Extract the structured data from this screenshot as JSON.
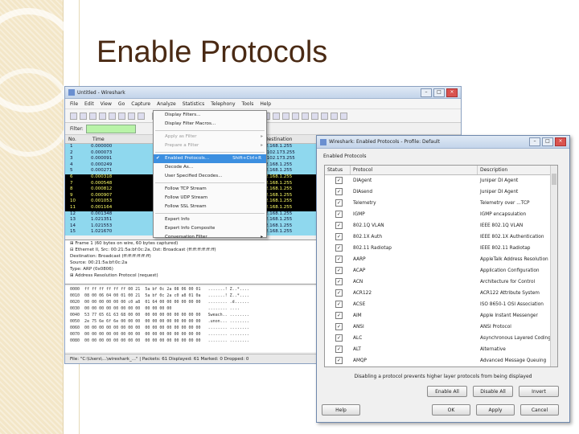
{
  "slide": {
    "title": "Enable Protocols"
  },
  "main_window": {
    "title": "Untitled - Wireshark",
    "menus": [
      "File",
      "Edit",
      "View",
      "Go",
      "Capture",
      "Analyze",
      "Statistics",
      "Telephony",
      "Tools",
      "Help"
    ],
    "filter_label": "Filter:",
    "packet_columns": [
      "No.",
      "Time",
      "Destination"
    ],
    "packets": [
      {
        "no": "1",
        "time": "0.000000",
        "dest": "192.168.1.255",
        "style": "c"
      },
      {
        "no": "2",
        "time": "0.000073",
        "dest": "66.102.173.255",
        "style": "c"
      },
      {
        "no": "3",
        "time": "0.000091",
        "dest": "66.102.173.255",
        "style": "c"
      },
      {
        "no": "4",
        "time": "0.000249",
        "dest": "192.168.1.255",
        "style": "c"
      },
      {
        "no": "5",
        "time": "0.000271",
        "dest": "192.168.1.255",
        "style": "c"
      },
      {
        "no": "6",
        "time": "0.000318",
        "dest": "192.168.1.255",
        "style": "k"
      },
      {
        "no": "7",
        "time": "0.000548",
        "dest": "192.168.1.255",
        "style": "k"
      },
      {
        "no": "8",
        "time": "0.000812",
        "dest": "192.168.1.255",
        "style": "k"
      },
      {
        "no": "9",
        "time": "0.000907",
        "dest": "192.168.1.255",
        "style": "k"
      },
      {
        "no": "10",
        "time": "0.001053",
        "dest": "192.168.1.255",
        "style": "k"
      },
      {
        "no": "11",
        "time": "0.001164",
        "dest": "192.168.1.255",
        "style": "k"
      },
      {
        "no": "12",
        "time": "0.001348",
        "dest": "192.168.1.255",
        "style": "c"
      },
      {
        "no": "13",
        "time": "1.021351",
        "dest": "192.168.1.255",
        "style": "c"
      },
      {
        "no": "14",
        "time": "1.021553",
        "dest": "192.168.1.255",
        "style": "c"
      },
      {
        "no": "15",
        "time": "1.021670",
        "dest": "192.168.1.255",
        "style": "c"
      }
    ],
    "details": [
      "⊞ Frame 1 (60 bytes on wire, 60 bytes captured)",
      "⊟ Ethernet II, Src: 00:21:5a:bf:0c:2a, Dst: Broadcast (ff:ff:ff:ff:ff:ff)",
      "    Destination: Broadcast (ff:ff:ff:ff:ff:ff)",
      "    Source: 00:21:5a:bf:0c:2a",
      "    Type: ARP (0x0806)",
      "⊞ Address Resolution Protocol (request)"
    ],
    "hex": [
      "0000  ff ff ff ff ff ff 00 21  5a bf 0c 2a 08 06 00 01   .......! Z..*....",
      "0010  08 00 06 04 00 01 00 21  5a bf 0c 2a c0 a8 01 0a   .......! Z..*....",
      "0020  00 00 00 00 00 00 c0 a8  01 64 00 00 00 00 00 00   ........ .d......",
      "0030  00 00 00 00 00 00 00 00  00 00 00 00               ........ ....",
      "0040  53 77 65 61 63 68 00 00  00 00 00 00 00 00 00 00   Sweach.. ........",
      "0050  2e 75 6e 6f 6e 00 00 00  00 00 00 00 00 00 00 00   .unon... ........",
      "0060  00 00 00 00 00 00 00 00  00 00 00 00 00 00 00 00   ........ ........",
      "0070  00 00 00 00 00 00 00 00  00 00 00 00 00 00 00 00   ........ ........",
      "0080  00 00 00 00 00 00 00 00  00 00 00 00 00 00 00 00   ........ ........"
    ],
    "status": "File: \"C:\\Users\\...\\wireshark_...\" | Packets: 61 Displayed: 61 Marked: 0 Dropped: 0"
  },
  "analyze_menu": {
    "items": [
      {
        "label": "Display Filters...",
        "enabled": true
      },
      {
        "label": "Display Filter Macros...",
        "enabled": true
      },
      {
        "sep": true
      },
      {
        "label": "Apply as Filter",
        "enabled": false,
        "submenu": true
      },
      {
        "label": "Prepare a Filter",
        "enabled": false,
        "submenu": true
      },
      {
        "sep": true
      },
      {
        "label": "Enabled Protocols...",
        "shortcut": "Shift+Ctrl+R",
        "highlight": true,
        "check": "✔"
      },
      {
        "label": "Decode As...",
        "enabled": true
      },
      {
        "label": "User Specified Decodes...",
        "enabled": true
      },
      {
        "sep": true
      },
      {
        "label": "Follow TCP Stream",
        "enabled": true
      },
      {
        "label": "Follow UDP Stream",
        "enabled": true
      },
      {
        "label": "Follow SSL Stream",
        "enabled": true
      },
      {
        "sep": true
      },
      {
        "label": "Expert Info",
        "enabled": true
      },
      {
        "label": "Expert Info Composite",
        "enabled": true
      },
      {
        "label": "Conversation Filter",
        "enabled": true,
        "submenu": true
      }
    ]
  },
  "dialog": {
    "title": "Wireshark: Enabled Protocols - Profile: Default",
    "group_label": "Enabled Protocols",
    "columns": [
      "Status",
      "Protocol",
      "Description"
    ],
    "rows": [
      {
        "protocol": "DIAgent",
        "description": "Juniper DI Agent"
      },
      {
        "protocol": "DIAsend",
        "description": "Juniper DI Agent"
      },
      {
        "protocol": "Telemetry",
        "description": "Telemetry over ...TCP"
      },
      {
        "protocol": "IGMP",
        "description": "IGMP encapsulation"
      },
      {
        "protocol": "802.1Q VLAN",
        "description": "IEEE 802.1Q VLAN"
      },
      {
        "protocol": "802.1X Auth",
        "description": "IEEE 802.1X Authentication"
      },
      {
        "protocol": "802.11 Radiotap",
        "description": "IEEE 802.11 Radiotap"
      },
      {
        "protocol": "AARP",
        "description": "AppleTalk Address Resolution"
      },
      {
        "protocol": "ACAP",
        "description": "Application Configuration"
      },
      {
        "protocol": "ACN",
        "description": "Architecture for Control"
      },
      {
        "protocol": "ACR122",
        "description": "ACR122 Attribute System"
      },
      {
        "protocol": "ACSE",
        "description": "ISO 8650-1 OSI Association"
      },
      {
        "protocol": "AIM",
        "description": "Apple Instant Messenger"
      },
      {
        "protocol": "ANSI",
        "description": "ANSI Protocol"
      },
      {
        "protocol": "ALC",
        "description": "Asynchronous Layered Coding"
      },
      {
        "protocol": "ALT",
        "description": "Alternative"
      },
      {
        "protocol": "AMQP",
        "description": "Advanced Message Queuing"
      }
    ],
    "note": "Disabling a protocol prevents higher layer protocols from being displayed",
    "buttons": {
      "enable_all": "Enable All",
      "disable_all": "Disable All",
      "invert": "Invert",
      "help": "Help",
      "ok": "OK",
      "apply": "Apply",
      "cancel": "Cancel"
    }
  }
}
